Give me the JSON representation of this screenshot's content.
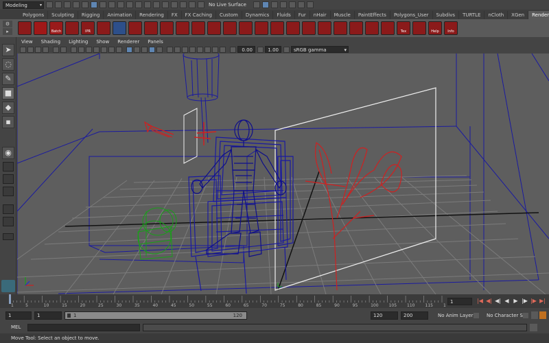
{
  "topbar": {
    "mode": "Modeling",
    "live_surface": "No Live Surface"
  },
  "shelf_tabs": [
    {
      "label": "Polygons",
      "active": false
    },
    {
      "label": "Sculpting",
      "active": false
    },
    {
      "label": "Rigging",
      "active": false
    },
    {
      "label": "Animation",
      "active": false
    },
    {
      "label": "Rendering",
      "active": false
    },
    {
      "label": "FX",
      "active": false
    },
    {
      "label": "FX Caching",
      "active": false
    },
    {
      "label": "Custom",
      "active": false
    },
    {
      "label": "Dynamics",
      "active": false
    },
    {
      "label": "Fluids",
      "active": false
    },
    {
      "label": "Fur",
      "active": false
    },
    {
      "label": "nHair",
      "active": false
    },
    {
      "label": "Muscle",
      "active": false
    },
    {
      "label": "PaintEffects",
      "active": false
    },
    {
      "label": "Polygons_User",
      "active": false
    },
    {
      "label": "Subdivs",
      "active": false
    },
    {
      "label": "TURTLE",
      "active": false
    },
    {
      "label": "nCloth",
      "active": false
    },
    {
      "label": "XGen",
      "active": false
    },
    {
      "label": "RenderMan",
      "active": true
    }
  ],
  "shelf": {
    "icons": [
      {
        "name": "render-settings-icon",
        "color": "#8b1a1a",
        "label": ""
      },
      {
        "name": "render-icon",
        "color": "#a01818",
        "label": ""
      },
      {
        "name": "batch-render-icon",
        "color": "#9a1a1a",
        "label": "Batch"
      },
      {
        "name": "eye-icon",
        "color": "#8b1a1a",
        "label": ""
      },
      {
        "name": "ipr-icon",
        "color": "#8b1a1a",
        "label": "IPR"
      },
      {
        "name": "light-bulb-icon",
        "color": "#8b1a1a",
        "label": ""
      },
      {
        "name": "sphere-icon",
        "color": "#2d4f8a",
        "label": ""
      },
      {
        "name": "shader-sphere-icon",
        "color": "#8b1a1a",
        "label": ""
      },
      {
        "name": "shader-sphere-2-icon",
        "color": "#8b1a1a",
        "label": ""
      },
      {
        "name": "ring-light-icon",
        "color": "#8b1a1a",
        "label": ""
      },
      {
        "name": "area-light-icon",
        "color": "#8b1a1a",
        "label": ""
      },
      {
        "name": "env-light-icon",
        "color": "#8b1a1a",
        "label": ""
      },
      {
        "name": "portal-light-icon",
        "color": "#8b1a1a",
        "label": ""
      },
      {
        "name": "ramp-icon",
        "color": "#8b1a1a",
        "label": ""
      },
      {
        "name": "image-icon",
        "color": "#8b1a1a",
        "label": ""
      },
      {
        "name": "pin-icon",
        "color": "#8b1a1a",
        "label": ""
      },
      {
        "name": "hair-icon",
        "color": "#8b1a1a",
        "label": ""
      },
      {
        "name": "shader-ball-icon",
        "color": "#8b1a1a",
        "label": ""
      },
      {
        "name": "stop-icon",
        "color": "#8b1a1a",
        "label": ""
      },
      {
        "name": "fire-icon",
        "color": "#8b1a1a",
        "label": ""
      },
      {
        "name": "bulb-icon",
        "color": "#8b1a1a",
        "label": ""
      },
      {
        "name": "sun-icon",
        "color": "#8b1a1a",
        "label": ""
      },
      {
        "name": "cross-icon",
        "color": "#8b1a1a",
        "label": ""
      },
      {
        "name": "cube-icon",
        "color": "#8b1a1a",
        "label": ""
      },
      {
        "name": "texture-icon",
        "color": "#8b1a1a",
        "label": "Tex"
      },
      {
        "name": "wave-icon",
        "color": "#8b1a1a",
        "label": ""
      },
      {
        "name": "help-icon",
        "color": "#8b1a1a",
        "label": "Help"
      },
      {
        "name": "info-icon",
        "color": "#8b1a1a",
        "label": "Info"
      }
    ]
  },
  "viewport_menus": [
    "View",
    "Shading",
    "Lighting",
    "Show",
    "Renderer",
    "Panels"
  ],
  "viewport_toolbar": {
    "exposure": "0.00",
    "gamma": "1.00",
    "color_space": "sRGB gamma"
  },
  "timeline": {
    "ticks": [
      "1",
      "5",
      "10",
      "15",
      "20",
      "25",
      "30",
      "35",
      "40",
      "45",
      "50",
      "55",
      "60",
      "65",
      "70",
      "75",
      "80",
      "85",
      "90",
      "95",
      "100",
      "105",
      "110",
      "115",
      "120"
    ],
    "current_frame": "1"
  },
  "range": {
    "start": "1",
    "playback_start": "1",
    "bar_left": "1",
    "bar_right": "120",
    "playback_end": "120",
    "end": "200",
    "anim_layer": "No Anim Layer",
    "character_set": "No Character Set"
  },
  "cmdline": {
    "mel_label": "MEL"
  },
  "helpline": "Move Tool: Select an object to move.",
  "colors": {
    "viewport_bg": "#5e5e5e",
    "selection_blue": "#1a1aa0",
    "light_red": "#d02020",
    "helper_green": "#18a018",
    "accent_blue": "#5f86b3"
  }
}
